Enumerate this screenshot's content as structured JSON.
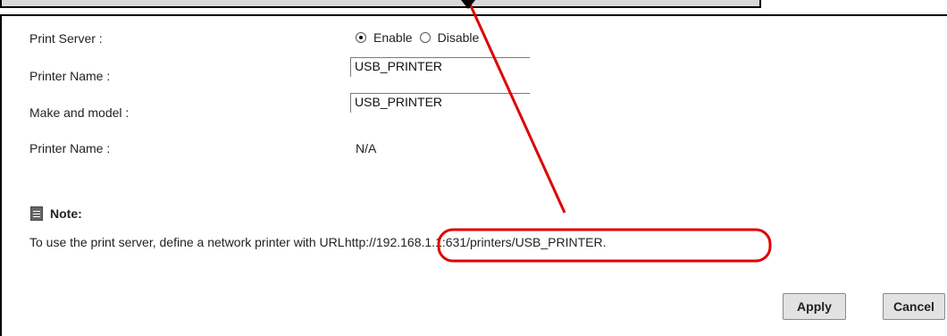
{
  "form": {
    "print_server": {
      "label": "Print Server :",
      "options": [
        "Enable",
        "Disable"
      ],
      "selected": "Enable"
    },
    "printer_name": {
      "label": "Printer Name :",
      "value": "USB_PRINTER"
    },
    "make_model": {
      "label": "Make and model :",
      "value": "USB_PRINTER"
    },
    "printer_status": {
      "label": "Printer Name :",
      "value": "N/A"
    }
  },
  "note": {
    "title": "Note:",
    "text_prefix": "To use the print server, define a network printer with URL",
    "url": "http://192.168.1.1:631/printers/USB_PRINTER."
  },
  "buttons": {
    "apply": "Apply",
    "cancel": "Cancel"
  },
  "annotation": {
    "color": "#e00000"
  }
}
